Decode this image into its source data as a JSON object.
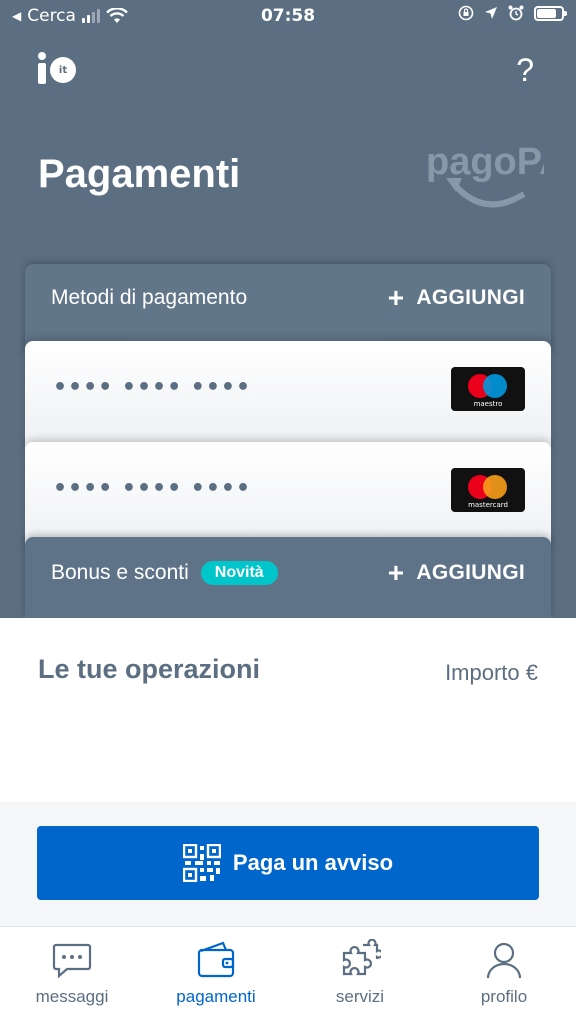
{
  "status_bar": {
    "back_label": "Cerca",
    "time": "07:58"
  },
  "header": {
    "logo_text": "io",
    "logo_badge": "it",
    "help_label": "?",
    "title": "Pagamenti",
    "brand_logo": "pagoPA"
  },
  "payment_methods": {
    "label": "Metodi di pagamento",
    "add_label": "AGGIUNGI",
    "cards": [
      {
        "number": "•••• •••• ••••",
        "brand": "maestro"
      },
      {
        "number": "•••• •••• ••••",
        "brand": "mastercard"
      }
    ]
  },
  "bonus": {
    "label": "Bonus e sconti",
    "badge": "Novità",
    "add_label": "AGGIUNGI"
  },
  "operations": {
    "title": "Le tue operazioni",
    "amount_label": "Importo €"
  },
  "pay_notice": {
    "label": "Paga un avviso"
  },
  "tabs": [
    {
      "label": "messaggi",
      "icon": "chat-icon"
    },
    {
      "label": "pagamenti",
      "icon": "wallet-icon"
    },
    {
      "label": "servizi",
      "icon": "puzzle-icon"
    },
    {
      "label": "profilo",
      "icon": "person-icon"
    }
  ],
  "colors": {
    "header_bg": "#5c6f82",
    "accent": "#0066cc",
    "badge": "#00c5ca"
  }
}
